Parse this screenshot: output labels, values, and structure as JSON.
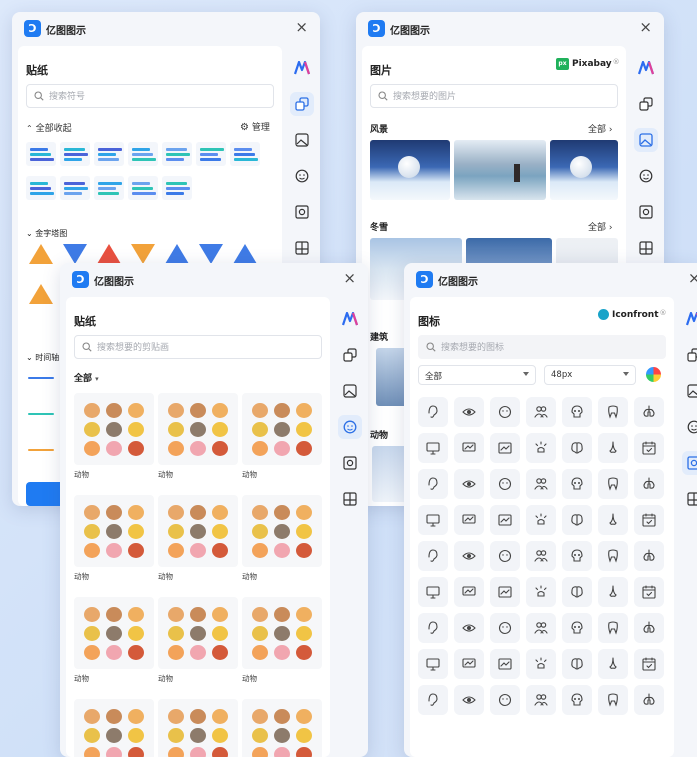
{
  "colors": {
    "accent": "#1f7bf2",
    "close": "#444444",
    "bg": "#d6e3f7"
  },
  "app": {
    "logo_text": "亿图图示",
    "close_glyph": "×"
  },
  "p1": {
    "title": "贴纸",
    "search_placeholder": "搜索符号",
    "collapse_all": "全部收起",
    "manage": "管理",
    "section_pyramid": "金字塔图",
    "section_timeline": "时间轴"
  },
  "p2": {
    "title": "图片",
    "brand": "Pixabay",
    "brand_mark": "®",
    "search_placeholder": "搜索想要的图片",
    "sections": [
      {
        "name": "风景",
        "more": "全部"
      },
      {
        "name": "冬雪",
        "more": "全部"
      },
      {
        "name": "建筑"
      },
      {
        "name": "动物"
      }
    ]
  },
  "p3": {
    "title": "贴纸",
    "search_placeholder": "搜索想要的剪贴画",
    "filter": "全部",
    "card_label": "动物"
  },
  "p4": {
    "title": "图标",
    "brand": "Iconfront",
    "brand_mark": "®",
    "search_placeholder": "搜索想要的图标",
    "select_all": "全部",
    "select_size": "48px"
  },
  "rail_icons": [
    "ai-brand-icon",
    "shapes-icon",
    "image-icon",
    "sticker-icon",
    "icon-library-icon",
    "template-icon"
  ]
}
